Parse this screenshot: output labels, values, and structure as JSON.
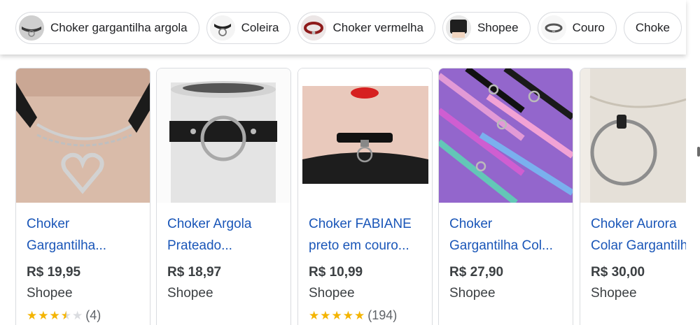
{
  "chips": [
    {
      "label": "Choker gargantilha argola"
    },
    {
      "label": "Coleira"
    },
    {
      "label": "Choker vermelha"
    },
    {
      "label": "Shopee"
    },
    {
      "label": "Couro"
    },
    {
      "label": "Choke"
    }
  ],
  "products": [
    {
      "title1": "Choker",
      "title2": "Gargantilha...",
      "price": "R$ 19,95",
      "store": "Shopee",
      "rating": 3.5,
      "count": "(4)"
    },
    {
      "title1": "Choker Argola",
      "title2": "Prateado...",
      "price": "R$ 18,97",
      "store": "Shopee"
    },
    {
      "title1": "Choker FABIANE",
      "title2": "preto em couro...",
      "price": "R$ 10,99",
      "store": "Shopee",
      "rating": 5,
      "count": "(194)"
    },
    {
      "title1": "Choker",
      "title2": "Gargantilha Col...",
      "price": "R$ 27,90",
      "store": "Shopee"
    },
    {
      "title1": "Choker Aurora",
      "title2": "Colar Gargantilh",
      "price": "R$ 30,00",
      "store": "Shopee"
    }
  ],
  "colors": {
    "link": "#1a56b8",
    "star": "#f4b400",
    "border": "#dadce0"
  }
}
